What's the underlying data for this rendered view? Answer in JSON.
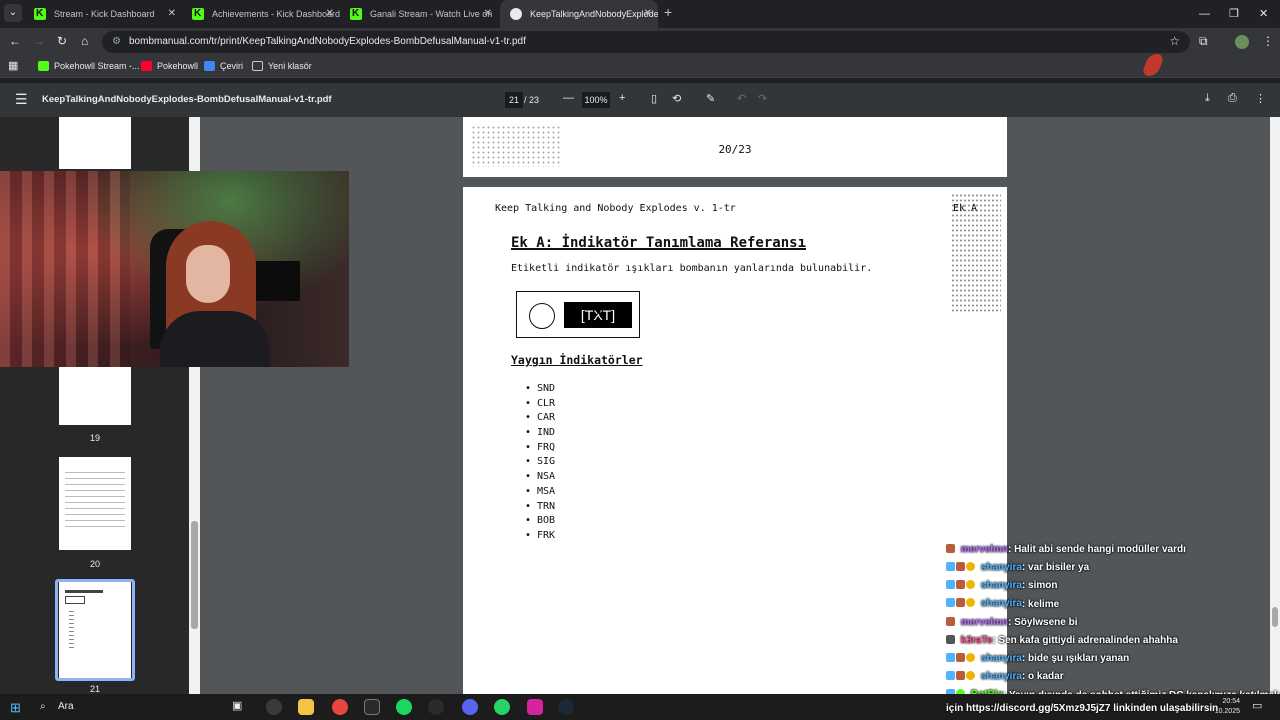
{
  "tabs": [
    {
      "title": "Stream - Kick Dashboard",
      "icon": "kick-icon"
    },
    {
      "title": "Achievements - Kick Dashboard",
      "icon": "kick-icon"
    },
    {
      "title": "Ganali Stream - Watch Live on",
      "icon": "kick-icon"
    },
    {
      "title": "KeepTalkingAndNobodyExplode",
      "icon": "pdf-icon"
    }
  ],
  "address": {
    "url": "bombmanual.com/tr/print/KeepTalkingAndNobodyExplodes-BombDefusalManual-v1-tr.pdf"
  },
  "bookmarks": [
    {
      "label": "Pokehowll Stream -...",
      "color": "#53fc18"
    },
    {
      "label": "Pokehowll",
      "color": "#ff0033"
    },
    {
      "label": "Çeviri",
      "color": "#4285f4"
    },
    {
      "label": "Yeni klasör",
      "color": "#9aa0a6"
    }
  ],
  "pdf": {
    "filename": "KeepTalkingAndNobodyExplodes-BombDefusalManual-v1-tr.pdf",
    "current_page": "21",
    "total_pages": "/ 23",
    "zoom": "100%"
  },
  "thumbnails": [
    {
      "label": "19"
    },
    {
      "label": "20"
    },
    {
      "label": "21"
    }
  ],
  "prev_page": {
    "footer": "20/23"
  },
  "page": {
    "header": "Keep Talking and Nobody Explodes v. 1-tr",
    "section": "Ek A",
    "heading": "Ek A: İndikatör Tanımlama Referansı",
    "intro": "Etiketli indikatör ışıkları bombanın yanlarında bulunabilir.",
    "indicator_label": "[TXT]",
    "subheading": "Yaygın İndikatörler",
    "indicators": [
      "SND",
      "CLR",
      "CAR",
      "IND",
      "FRQ",
      "SIG",
      "NSA",
      "MSA",
      "TRN",
      "BOB",
      "FRK"
    ]
  },
  "chat": [
    {
      "user": "mervelmn",
      "color": "#b36bff",
      "text": ": Halit abi sende hangi modüller vardı"
    },
    {
      "user": "shanyira",
      "color": "#4fb3ff",
      "text": ": var bisiler ya"
    },
    {
      "user": "shanyira",
      "color": "#4fb3ff",
      "text": ": simon"
    },
    {
      "user": "shanyira",
      "color": "#4fb3ff",
      "text": ": kelime"
    },
    {
      "user": "mervelmn",
      "color": "#b36bff",
      "text": ": Söylwsene bi"
    },
    {
      "user": "k3raTe",
      "color": "#ff4f8b",
      "text": ": Sen kafa gittiydi adrenalinden ahahha"
    },
    {
      "user": "shanyira",
      "color": "#4fb3ff",
      "text": ": bide şu ışıkları yanan"
    },
    {
      "user": "shanyira",
      "color": "#4fb3ff",
      "text": ": o kadar"
    },
    {
      "user": "BotRix",
      "color": "#53fc18",
      "text": ": Yayın dışında da sohbet ettiğimiz DC kanalımıza katılmak"
    }
  ],
  "chat_link": "için https://discord.gg/5Xmz9J5jZ7 linkinden ulaşabilirsin",
  "taskbar": {
    "search": "Ara",
    "time": "20:54",
    "date": "10.2025"
  }
}
